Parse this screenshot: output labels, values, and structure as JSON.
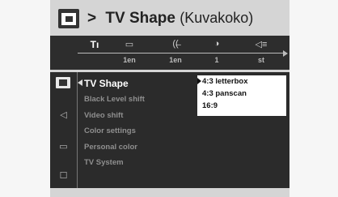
{
  "header": {
    "arrow": ">",
    "title": "TV Shape",
    "subtitle": "(Kuvakoko)",
    "icon": "tv-screen-icon"
  },
  "topbar": {
    "icons": [
      "settings-icon",
      "subtitle-icon",
      "audio-icon",
      "angle-icon",
      "volume-icon"
    ],
    "glyphs": [
      "Tı",
      "▭",
      "((̶",
      "◑",
      "◁≡"
    ],
    "values": [
      "1en",
      "1en",
      "1",
      "st"
    ]
  },
  "sidebar": {
    "icons": [
      "tv-screen-icon",
      "speaker-icon",
      "chat-icon",
      "briefcase-icon"
    ],
    "glyphs": [
      "",
      "◁",
      "▭",
      "☐"
    ]
  },
  "menu": {
    "items": [
      "TV Shape",
      "Black Level shift",
      "Video shift",
      "Color settings",
      "Personal color",
      "TV System"
    ],
    "active_index": 0
  },
  "submenu": {
    "options": [
      "4:3 letterbox",
      "4:3 panscan",
      "16:9"
    ],
    "selected_index": 0
  },
  "colors": {
    "panel": "#d5d5d5",
    "dark": "#2b2b2b",
    "active_text": "#ffffff",
    "inactive_text": "#8f8f8f"
  }
}
